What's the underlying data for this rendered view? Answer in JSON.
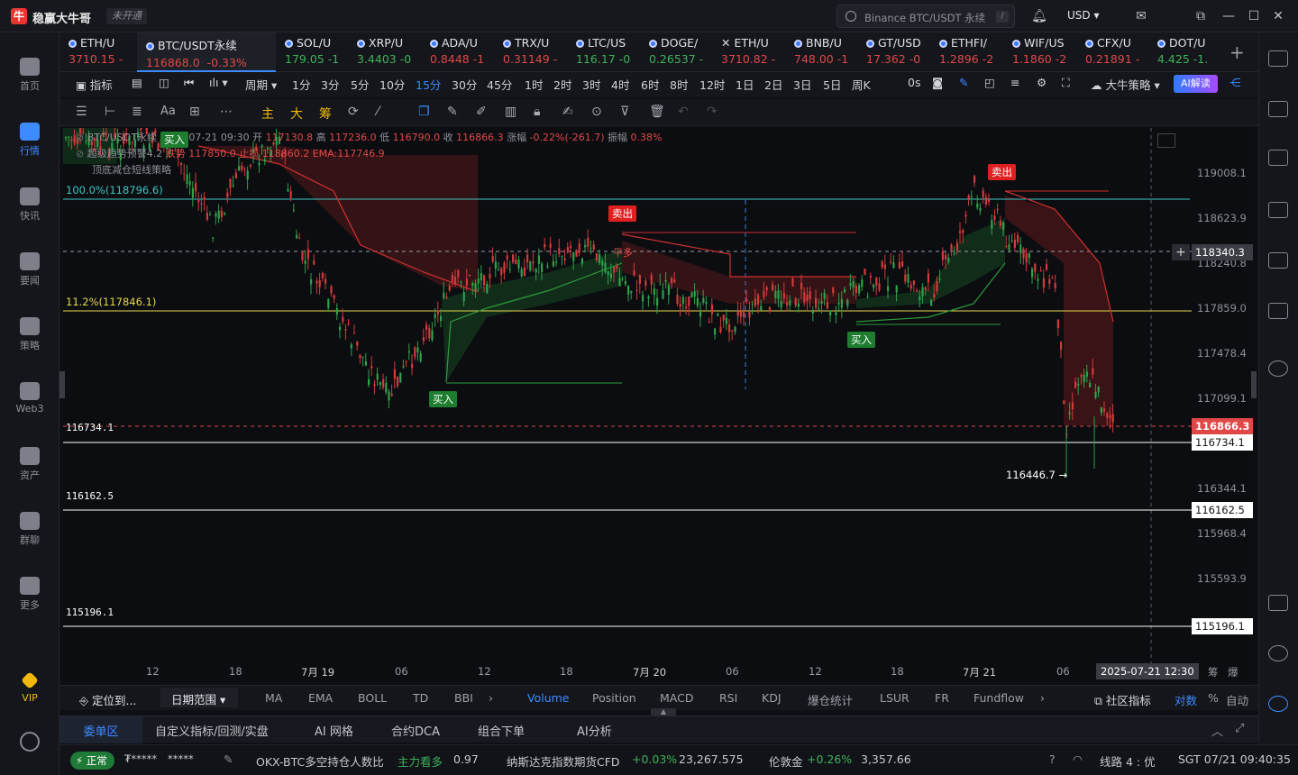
{
  "app": {
    "name": "稳赢大牛哥",
    "status_badge": "未开通",
    "search_placeholder": "Binance BTC/USDT 永续",
    "search_key": "/",
    "currency": "USD"
  },
  "sidebar": {
    "items": [
      {
        "label": "首页",
        "icon": "home-icon"
      },
      {
        "label": "行情",
        "icon": "chart-bars-icon",
        "active": true
      },
      {
        "label": "快讯",
        "icon": "news-icon"
      },
      {
        "label": "要闻",
        "icon": "article-icon"
      },
      {
        "label": "策略",
        "icon": "robot-icon"
      },
      {
        "label": "Web3",
        "icon": "web3-icon"
      },
      {
        "label": "资产",
        "icon": "wallet-icon"
      },
      {
        "label": "群聊",
        "icon": "chat-icon"
      },
      {
        "label": "更多",
        "icon": "grid-icon"
      },
      {
        "label": "VIP",
        "icon": "diamond-icon"
      }
    ]
  },
  "tabs": [
    {
      "name": "ETH/U",
      "price": "3710.15",
      "change": "-",
      "dir": "down"
    },
    {
      "name": "BTC/USDT永续",
      "price": "116868.0",
      "change": "-0.33%",
      "dir": "down",
      "active": true
    },
    {
      "name": "SOL/U",
      "price": "179.05",
      "change": "-1",
      "dir": "up"
    },
    {
      "name": "XRP/U",
      "price": "3.4403",
      "change": "-0",
      "dir": "up"
    },
    {
      "name": "ADA/U",
      "price": "0.8448",
      "change": "-1",
      "dir": "down"
    },
    {
      "name": "TRX/U",
      "price": "0.31149",
      "change": "-",
      "dir": "down"
    },
    {
      "name": "LTC/US",
      "price": "116.17",
      "change": "-0",
      "dir": "up"
    },
    {
      "name": "DOGE/",
      "price": "0.26537",
      "change": "-",
      "dir": "up"
    },
    {
      "name": "ETH/U",
      "price": "3710.82",
      "change": "-",
      "dir": "down"
    },
    {
      "name": "BNB/U",
      "price": "748.00",
      "change": "-1",
      "dir": "down"
    },
    {
      "name": "GT/USD",
      "price": "17.362",
      "change": "-0",
      "dir": "down"
    },
    {
      "name": "ETHFI/",
      "price": "1.2896",
      "change": "-2",
      "dir": "down"
    },
    {
      "name": "WIF/US",
      "price": "1.1860",
      "change": "-2",
      "dir": "down"
    },
    {
      "name": "CFX/U",
      "price": "0.21891",
      "change": "-",
      "dir": "down"
    },
    {
      "name": "DOT/U",
      "price": "4.425",
      "change": "-1.",
      "dir": "up"
    }
  ],
  "intervals": {
    "indicator_label": "指标",
    "period_label": "周期",
    "items": [
      "1分",
      "3分",
      "5分",
      "10分",
      "15分",
      "30分",
      "45分",
      "1时",
      "2时",
      "3时",
      "4时",
      "6时",
      "8时",
      "12时",
      "1日",
      "2日",
      "3日",
      "5日",
      "周K"
    ],
    "selected": "15分",
    "countdown": "0s",
    "strategy_label": "大牛策略",
    "ai_label": "AI解读"
  },
  "drawbar": {
    "main_label": "主",
    "big_label": "大",
    "chip_label": "筹"
  },
  "chart": {
    "symbol_line": "BTC/USDT永续 2025-07-21 09:30",
    "open_label": "开",
    "open": "117130.8",
    "high_label": "高",
    "high": "117236.0",
    "low_label": "低",
    "low": "116790.0",
    "close_label": "收",
    "close": "116866.3",
    "change_label": "涨幅",
    "change": "-0.22%(-261.7)",
    "amplitude_label": "振幅",
    "amplitude": "0.38%",
    "indicator1": "超级趋势预警4.2",
    "indicator1_a": "跌势",
    "indicator1_b": "117850.0",
    "indicator1_c": "止损",
    "indicator1_d": "118860.2",
    "indicator1_e": "EMA:117746.9",
    "indicator2": "顶底减仓短线策略",
    "fib_top": "100.0%(118796.6)",
    "fib_mid": "11.2%(117846.1)",
    "level_116734": "116734.1",
    "level_116162": "116162.5",
    "level_115196": "115196.1",
    "low_marker": "116446.7 →",
    "signal_buy": "买入",
    "signal_sell": "卖出",
    "signal_flat": "平多",
    "price_axis": [
      "119008.1",
      "118623.9",
      "118240.8",
      "117859.0",
      "117478.4",
      "117099.1",
      "116344.1",
      "115968.4",
      "115593.9"
    ],
    "crosshair_price": "118340.3",
    "current_price": "116866.3",
    "axis_116734": "116734.1",
    "axis_116162": "116162.5",
    "axis_115196": "115196.1",
    "time_labels": [
      "12",
      "18",
      "7月 19",
      "06",
      "12",
      "18",
      "7月 20",
      "06",
      "12",
      "18",
      "7月 21",
      "06"
    ],
    "crosshair_time": "2025-07-21 12:30",
    "axis_corner_a": "筹",
    "axis_corner_b": "爆"
  },
  "indicator_tabs": {
    "locate": "定位到...",
    "range": "日期范围",
    "items": [
      "MA",
      "EMA",
      "BOLL",
      "TD",
      "BBI"
    ],
    "sub_items": [
      "Volume",
      "Position",
      "MACD",
      "RSI",
      "KDJ",
      "爆仓统计",
      "LSUR",
      "FR",
      "Fundflow"
    ],
    "selected": "Volume",
    "community": "社区指标",
    "log": "对数",
    "percent": "%",
    "auto": "自动"
  },
  "panel_tabs": [
    "委单区",
    "自定义指标/回测/实盘",
    "AI 网格",
    "合约DCA",
    "组合下单",
    "AI分析"
  ],
  "panel_selected": "委单区",
  "statusbar": {
    "normal": "正常",
    "masked_a": "₮*****",
    "masked_b": "*****",
    "ticker1_name": "OKX-BTC多空持仓人数比",
    "ticker1_tag": "主力看多",
    "ticker1_value": "0.97",
    "ticker2_name": "纳斯达克指数期货CFD",
    "ticker2_change": "+0.03%",
    "ticker2_value": "23,267.575",
    "ticker3_name": "伦敦金",
    "ticker3_change": "+0.26%",
    "ticker3_value": "3,357.66",
    "line": "线路 4 : 优",
    "time": "SGT 07/21 09:40:35"
  },
  "colors": {
    "accent": "#3d8bff",
    "up": "#3fb25a",
    "down": "#e04848",
    "fib_top": "#3fc6c0",
    "fib_mid": "#e8d84a"
  }
}
